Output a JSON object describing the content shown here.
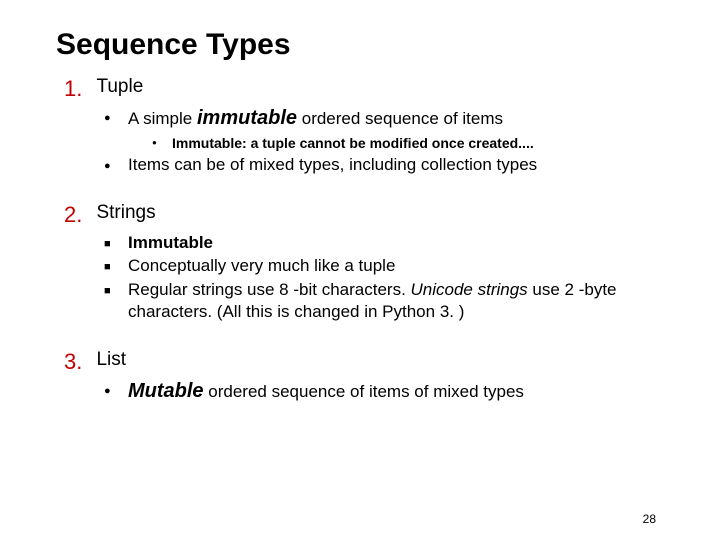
{
  "title": "Sequence Types",
  "pageNumber": "28",
  "items": [
    {
      "num": "1.",
      "header": "Tuple",
      "bullets_style": "disc",
      "bullets": [
        {
          "type": "immutable-line",
          "prefix": "A simple ",
          "keyword": "immutable",
          "suffix": " ordered sequence of items",
          "sub": [
            {
              "text": "Immutable: a tuple cannot be modified once created...."
            }
          ]
        },
        {
          "type": "plain",
          "text": "Items can be of mixed types, including collection types"
        }
      ]
    },
    {
      "num": "2.",
      "header": "Strings",
      "bullets_style": "sq",
      "bullets": [
        {
          "type": "bold",
          "text": "Immutable"
        },
        {
          "type": "plain",
          "text": "Conceptually very much like a tuple"
        },
        {
          "type": "unicode-line",
          "parts": [
            {
              "t": "Regular strings use 8 -bit characters. "
            },
            {
              "t": "Unicode strings",
              "italic": true
            },
            {
              "t": " use 2 -byte characters.  (All this is changed in Python 3. )"
            }
          ]
        }
      ]
    },
    {
      "num": "3.",
      "header": "List",
      "bullets_style": "disc",
      "bullets": [
        {
          "type": "mutable-line",
          "keyword": "Mutable",
          "suffix": " ordered sequence of items of mixed types"
        }
      ]
    }
  ]
}
